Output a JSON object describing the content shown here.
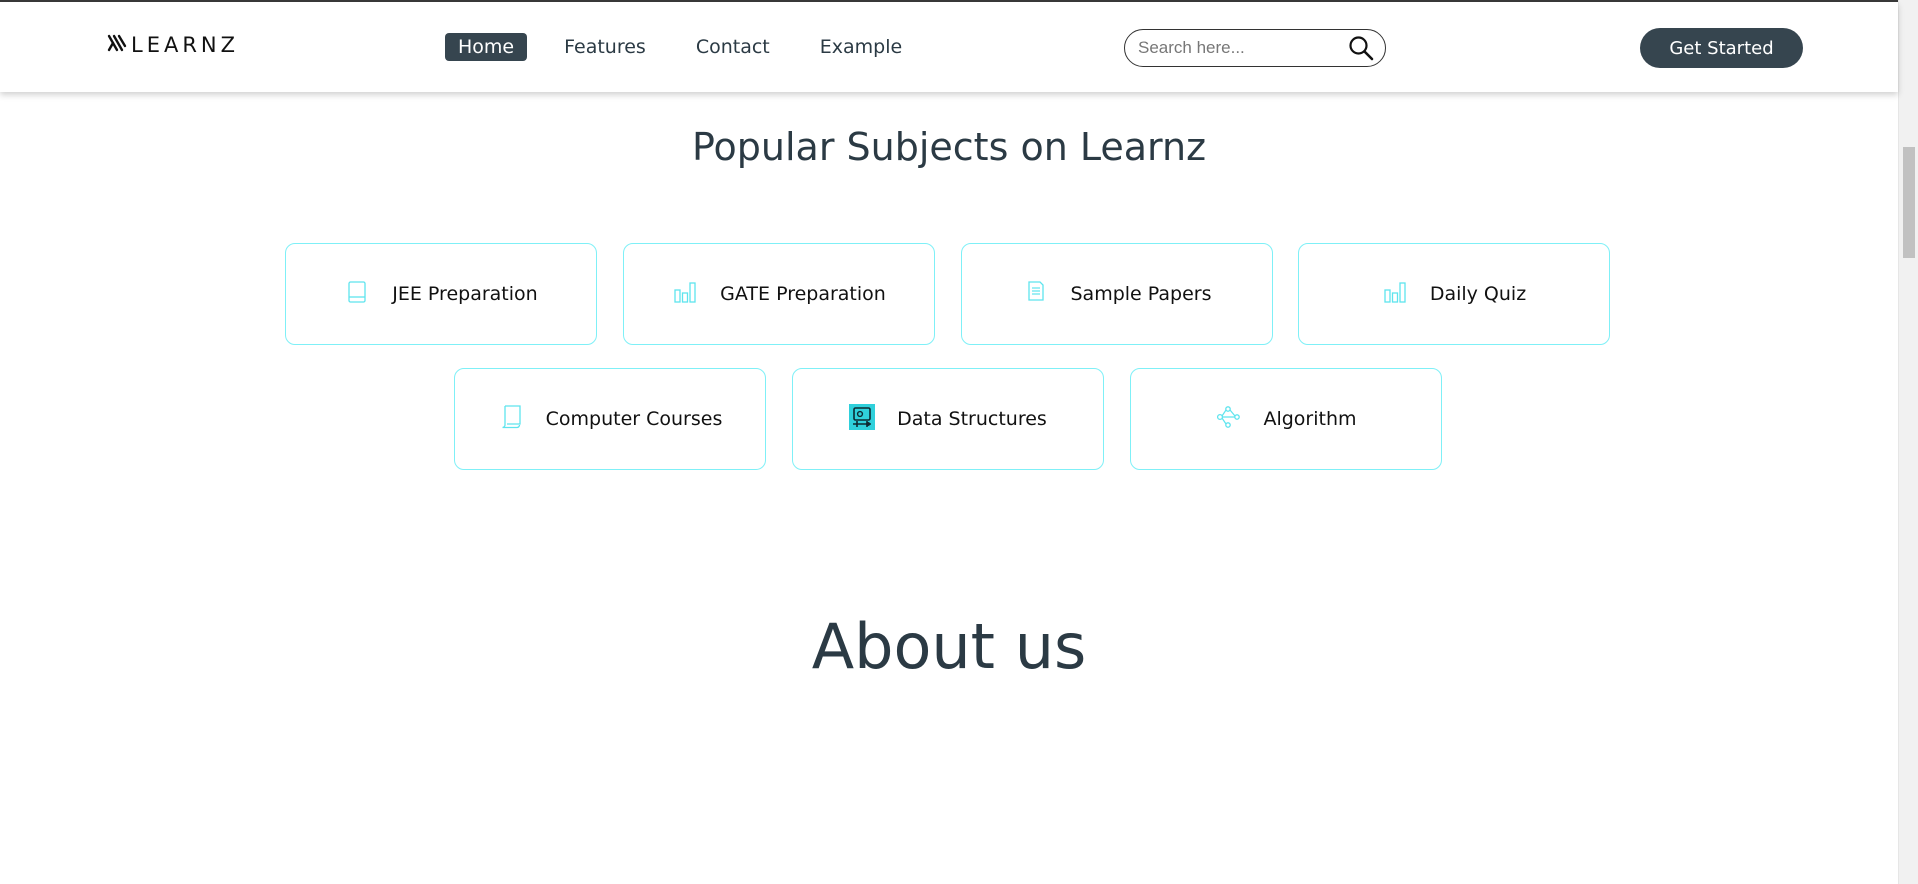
{
  "brand": {
    "name": "LEARNZ"
  },
  "nav": {
    "items": [
      {
        "label": "Home",
        "active": true
      },
      {
        "label": "Features",
        "active": false
      },
      {
        "label": "Contact",
        "active": false
      },
      {
        "label": "Example",
        "active": false
      }
    ]
  },
  "search": {
    "placeholder": "Search here...",
    "value": ""
  },
  "cta": {
    "label": "Get Started"
  },
  "subjects": {
    "title": "Popular Subjects on Learnz",
    "cards": [
      {
        "label": "JEE Preparation",
        "icon": "book-icon"
      },
      {
        "label": "GATE Preparation",
        "icon": "bar-chart-icon"
      },
      {
        "label": "Sample Papers",
        "icon": "document-icon"
      },
      {
        "label": "Daily Quiz",
        "icon": "bar-chart-icon"
      },
      {
        "label": "Computer Courses",
        "icon": "scroll-icon"
      },
      {
        "label": "Data Structures",
        "icon": "data-structure-icon"
      },
      {
        "label": "Algorithm",
        "icon": "algorithm-tree-icon"
      }
    ]
  },
  "about": {
    "title": "About us"
  },
  "colors": {
    "accent": "#36454f",
    "card_border": "#7ff0f7",
    "icon": "#5ee4ee"
  }
}
